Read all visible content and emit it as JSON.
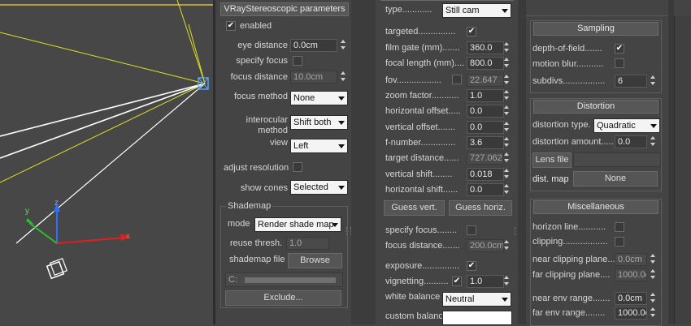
{
  "viewport": {
    "axis_labels": {
      "z": "z",
      "y": "y",
      "x": "x"
    }
  },
  "stereo": {
    "rollout_title": "VRayStereoscopic parameters",
    "enabled_label": "enabled",
    "enabled": true,
    "eye_distance_label": "eye distance",
    "eye_distance": "0.0cm",
    "specify_focus_label": "specify focus",
    "focus_distance_label": "focus distance",
    "focus_distance": "10.0cm",
    "focus_method_label": "focus method",
    "focus_method": "None",
    "interocular_label_1": "interocular",
    "interocular_label_2": "method",
    "interocular_method": "Shift both",
    "view_label": "view",
    "view": "Left",
    "adjust_resolution_label": "adjust resolution",
    "show_cones_label": "show cones",
    "show_cones": "Selected",
    "shademap": {
      "group_title": "Shademap",
      "mode_label": "mode",
      "mode": "Render shade map",
      "reuse_label": "reuse thresh.",
      "reuse_value": "1.0",
      "file_label": "shademap file",
      "browse_label": "Browse",
      "path_prefix": "C:",
      "exclude_label": "Exclude..."
    }
  },
  "camera": {
    "type_label": "type............",
    "type": "Still cam",
    "targeted_label": "targeted...............",
    "targeted": true,
    "film_gate_label": "film gate (mm).......",
    "film_gate": "360.0",
    "focal_length_label": "focal length (mm)....",
    "focal_length": "800.0",
    "fov_label": "fov..................",
    "fov": "22.647",
    "zoom_label": "zoom factor...........",
    "zoom": "1.0",
    "h_offset_label": "horizontal offset.....",
    "h_offset": "0.0",
    "v_offset_label": "vertical offset.......",
    "v_offset": "0.0",
    "fnumber_label": "f-number..............",
    "fnumber": "3.6",
    "target_distance_label": "target distance......",
    "target_distance": "727.062",
    "v_shift_label": "vertical shift........",
    "v_shift": "0.018",
    "h_shift_label": "horizontal shift......",
    "h_shift": "0.0",
    "guess_vert_label": "Guess vert.",
    "guess_horiz_label": "Guess horiz.",
    "specify_focus_label": "specify focus........",
    "focus_distance_label": "focus distance.......",
    "focus_distance": "200.0cm",
    "exposure_label": "exposure...............",
    "exposure": true,
    "vignetting_label": "vignetting..........",
    "vignetting": true,
    "vignetting_value": "1.0",
    "white_balance_label": "white balance",
    "white_balance": "Neutral",
    "custom_balance_label": "custom balance ......"
  },
  "sampling": {
    "title": "Sampling",
    "dof_label": "depth-of-field.......",
    "dof": true,
    "motion_blur_label": "motion blur...........",
    "subdivs_label": "subdivs.................",
    "subdivs": "6"
  },
  "distortion": {
    "title": "Distortion",
    "type_label": "distortion type.",
    "type": "Quadratic",
    "amount_label": "distortion amount.....",
    "amount": "0.0",
    "lens_file_label": "Lens file",
    "dist_map_label": "dist. map",
    "dist_map_value": "None"
  },
  "misc": {
    "title": "Miscellaneous",
    "horizon_label": "horizon line...........",
    "clipping_label": "clipping..................",
    "near_clip_label": "near clipping plane...",
    "near_clip": "0.0cm",
    "far_clip_label": "far clipping plane....",
    "far_clip": "1000.0cm",
    "near_env_label": "near env range.......",
    "near_env": "0.0cm",
    "far_env_label": "far env range........",
    "far_env": "1000.0cm"
  }
}
